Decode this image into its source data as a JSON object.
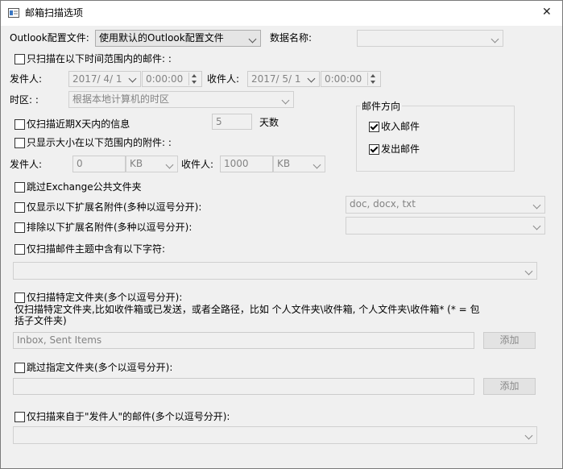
{
  "window": {
    "title": "邮箱扫描选项",
    "close_glyph": "✕"
  },
  "profile": {
    "label": "Outlook配置文件:",
    "selected": "使用默认的Outlook配置文件",
    "datastore_label": "数据名称:",
    "datastore_value": ""
  },
  "time_range": {
    "checkbox_label": "只扫描在以下时间范围内的邮件: :",
    "sender_label": "发件人:",
    "sender_date": "2017/ 4/ 1",
    "sender_time": "0:00:00",
    "recipient_label": "收件人:",
    "recipient_date": "2017/ 5/ 1",
    "recipient_time": "0:00:00",
    "timezone_label": "时区: :",
    "timezone_value": "根据本地计算机的时区"
  },
  "mail_direction": {
    "title": "邮件方向",
    "inbound_label": "收入邮件",
    "outbound_label": "发出邮件"
  },
  "recent_days": {
    "label": "仅扫描近期X天内的信息",
    "value": "5",
    "unit": "天数"
  },
  "attachment_size": {
    "checkbox_label": "只显示大小在以下范围内的附件: :",
    "from_label": "发件人:",
    "from_value": "0",
    "from_unit": "KB",
    "to_label": "收件人:",
    "to_value": "1000",
    "to_unit": "KB"
  },
  "options": {
    "skip_exchange": "跳过Exchange公共文件夹",
    "only_ext_label": "仅显示以下扩展名附件(多种以逗号分开):",
    "only_ext_value": "doc, docx, txt",
    "exclude_ext_label": "排除以下扩展名附件(多种以逗号分开):",
    "exclude_ext_value": "",
    "subject_label": "仅扫描邮件主题中含有以下字符:",
    "subject_value": "",
    "folders_label": "仅扫描特定文件夹(多个以逗号分开):",
    "folders_hint": "仅扫描特定文件夹,比如收件箱或已发送，或者全路径，比如   个人文件夹\\收件箱, 个人文件夹\\收件箱* (* = 包括子文件夹)",
    "folders_value": "Inbox, Sent Items",
    "folders_add": "添加",
    "skip_folders_label": "跳过指定文件夹(多个以逗号分开):",
    "skip_folders_value": "",
    "skip_folders_add": "添加",
    "senders_label": "仅扫描来自于\"发件人\"的邮件(多个以逗号分开):",
    "senders_value": ""
  }
}
